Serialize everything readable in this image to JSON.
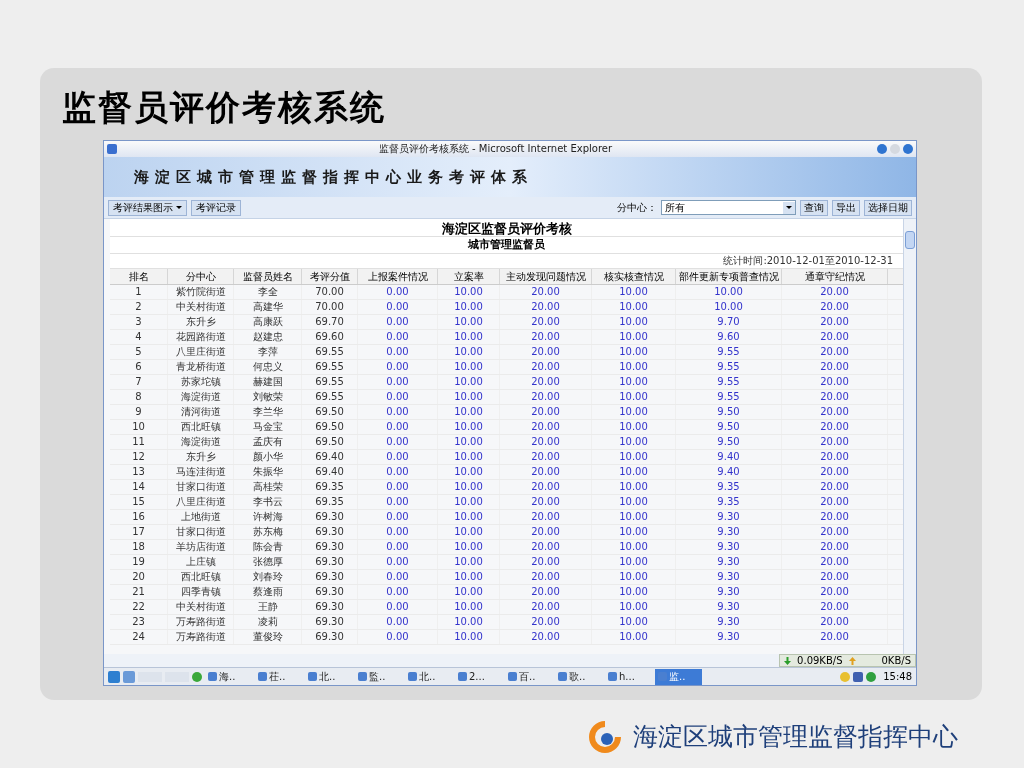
{
  "slide_title": "监督员评价考核系统",
  "window": {
    "title": "监督员评价考核系统 - Microsoft Internet Explorer"
  },
  "banner": "海淀区城市管理监督指挥中心业务考评体系",
  "toolbar": {
    "menus": [
      {
        "label": "考评结果图示",
        "kind": "dropdown"
      },
      {
        "label": "考评记录",
        "kind": "button"
      }
    ],
    "filter_label": "分中心：",
    "filter_value": "所有",
    "buttons": [
      "查询",
      "导出",
      "选择日期"
    ]
  },
  "report": {
    "title": "海淀区监督员评价考核",
    "subtitle": "城市管理监督员",
    "period": "统计时间:2010-12-01至2010-12-31"
  },
  "table": {
    "columns": [
      "排名",
      "分中心",
      "监督员姓名",
      "考评分值",
      "上报案件情况",
      "立案率",
      "主动发现问题情况",
      "核实核查情况",
      "部件更新专项普查情况",
      "通章守纪情况"
    ],
    "rows": [
      [
        "1",
        "紫竹院街道",
        "李全",
        "70.00",
        "0.00",
        "10.00",
        "20.00",
        "10.00",
        "10.00",
        "20.00"
      ],
      [
        "2",
        "中关村街道",
        "高建华",
        "70.00",
        "0.00",
        "10.00",
        "20.00",
        "10.00",
        "10.00",
        "20.00"
      ],
      [
        "3",
        "东升乡",
        "高康跃",
        "69.70",
        "0.00",
        "10.00",
        "20.00",
        "10.00",
        "9.70",
        "20.00"
      ],
      [
        "4",
        "花园路街道",
        "赵建忠",
        "69.60",
        "0.00",
        "10.00",
        "20.00",
        "10.00",
        "9.60",
        "20.00"
      ],
      [
        "5",
        "八里庄街道",
        "李萍",
        "69.55",
        "0.00",
        "10.00",
        "20.00",
        "10.00",
        "9.55",
        "20.00"
      ],
      [
        "6",
        "青龙桥街道",
        "何忠义",
        "69.55",
        "0.00",
        "10.00",
        "20.00",
        "10.00",
        "9.55",
        "20.00"
      ],
      [
        "7",
        "苏家坨镇",
        "赫建国",
        "69.55",
        "0.00",
        "10.00",
        "20.00",
        "10.00",
        "9.55",
        "20.00"
      ],
      [
        "8",
        "海淀街道",
        "刘敏荣",
        "69.55",
        "0.00",
        "10.00",
        "20.00",
        "10.00",
        "9.55",
        "20.00"
      ],
      [
        "9",
        "清河街道",
        "李兰华",
        "69.50",
        "0.00",
        "10.00",
        "20.00",
        "10.00",
        "9.50",
        "20.00"
      ],
      [
        "10",
        "西北旺镇",
        "马金宝",
        "69.50",
        "0.00",
        "10.00",
        "20.00",
        "10.00",
        "9.50",
        "20.00"
      ],
      [
        "11",
        "海淀街道",
        "孟庆有",
        "69.50",
        "0.00",
        "10.00",
        "20.00",
        "10.00",
        "9.50",
        "20.00"
      ],
      [
        "12",
        "东升乡",
        "颜小华",
        "69.40",
        "0.00",
        "10.00",
        "20.00",
        "10.00",
        "9.40",
        "20.00"
      ],
      [
        "13",
        "马连洼街道",
        "朱振华",
        "69.40",
        "0.00",
        "10.00",
        "20.00",
        "10.00",
        "9.40",
        "20.00"
      ],
      [
        "14",
        "甘家口街道",
        "高桂荣",
        "69.35",
        "0.00",
        "10.00",
        "20.00",
        "10.00",
        "9.35",
        "20.00"
      ],
      [
        "15",
        "八里庄街道",
        "李书云",
        "69.35",
        "0.00",
        "10.00",
        "20.00",
        "10.00",
        "9.35",
        "20.00"
      ],
      [
        "16",
        "上地街道",
        "许树海",
        "69.30",
        "0.00",
        "10.00",
        "20.00",
        "10.00",
        "9.30",
        "20.00"
      ],
      [
        "17",
        "甘家口街道",
        "苏东梅",
        "69.30",
        "0.00",
        "10.00",
        "20.00",
        "10.00",
        "9.30",
        "20.00"
      ],
      [
        "18",
        "羊坊店街道",
        "陈会青",
        "69.30",
        "0.00",
        "10.00",
        "20.00",
        "10.00",
        "9.30",
        "20.00"
      ],
      [
        "19",
        "上庄镇",
        "张德厚",
        "69.30",
        "0.00",
        "10.00",
        "20.00",
        "10.00",
        "9.30",
        "20.00"
      ],
      [
        "20",
        "西北旺镇",
        "刘春玲",
        "69.30",
        "0.00",
        "10.00",
        "20.00",
        "10.00",
        "9.30",
        "20.00"
      ],
      [
        "21",
        "四季青镇",
        "蔡逢雨",
        "69.30",
        "0.00",
        "10.00",
        "20.00",
        "10.00",
        "9.30",
        "20.00"
      ],
      [
        "22",
        "中关村街道",
        "王静",
        "69.30",
        "0.00",
        "10.00",
        "20.00",
        "10.00",
        "9.30",
        "20.00"
      ],
      [
        "23",
        "万寿路街道",
        "凌莉",
        "69.30",
        "0.00",
        "10.00",
        "20.00",
        "10.00",
        "9.30",
        "20.00"
      ],
      [
        "24",
        "万寿路街道",
        "董俊玲",
        "69.30",
        "0.00",
        "10.00",
        "20.00",
        "10.00",
        "9.30",
        "20.00"
      ]
    ]
  },
  "network": {
    "down": "0.09KB/S",
    "up": "0KB/S"
  },
  "taskbar": {
    "items": [
      {
        "label": "海..",
        "selected": false
      },
      {
        "label": "茌..",
        "selected": false
      },
      {
        "label": "北..",
        "selected": false
      },
      {
        "label": "監..",
        "selected": false
      },
      {
        "label": "北..",
        "selected": false
      },
      {
        "label": "2...",
        "selected": false
      },
      {
        "label": "百..",
        "selected": false
      },
      {
        "label": "歌..",
        "selected": false
      },
      {
        "label": "h...",
        "selected": false
      },
      {
        "label": "监..",
        "selected": true
      }
    ],
    "clock": "15:48"
  },
  "footer": "海淀区城市管理监督指挥中心"
}
